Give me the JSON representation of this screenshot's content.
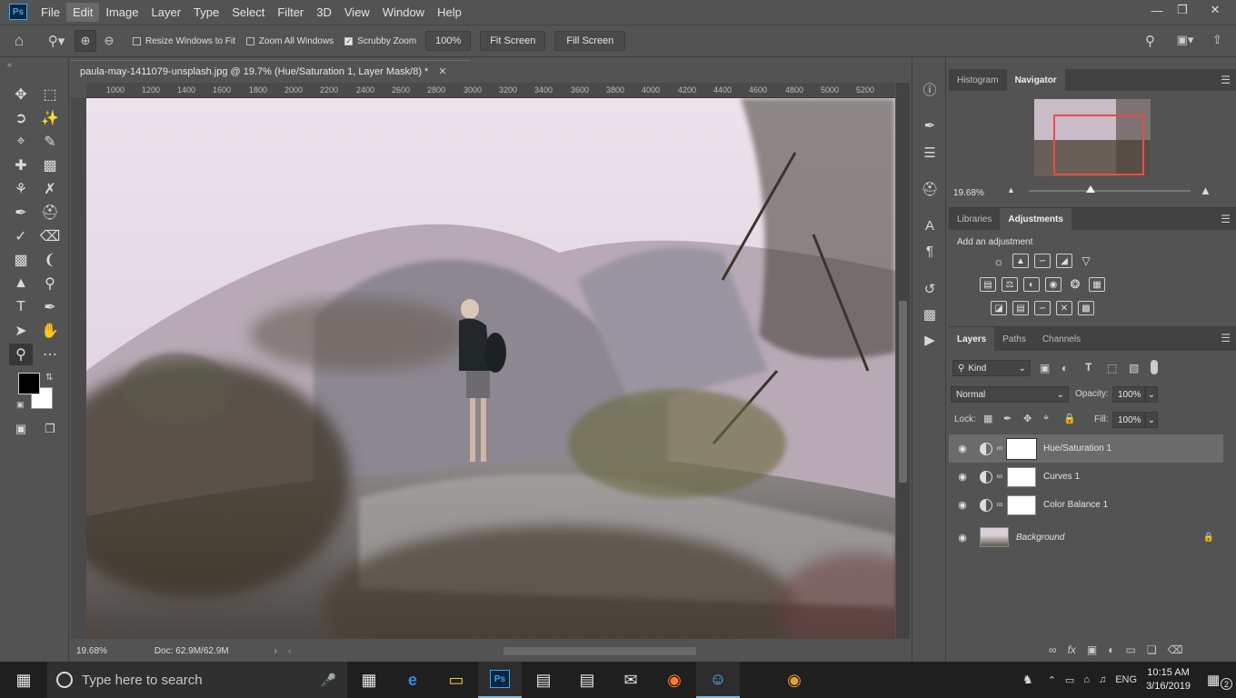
{
  "app": {
    "logo": "Ps"
  },
  "menu": [
    "File",
    "Edit",
    "Image",
    "Layer",
    "Type",
    "Select",
    "Filter",
    "3D",
    "View",
    "Window",
    "Help"
  ],
  "options": {
    "resize_windows": "Resize Windows to Fit",
    "zoom_all": "Zoom All Windows",
    "scrubby": "Scrubby Zoom",
    "zoom_value": "100%",
    "fit_screen": "Fit Screen",
    "fill_screen": "Fill Screen"
  },
  "document": {
    "tab_title": "paula-may-1411079-unsplash.jpg @ 19.7% (Hue/Saturation 1, Layer Mask/8) *",
    "ruler_ticks": [
      "1000",
      "1200",
      "1400",
      "1600",
      "1800",
      "2000",
      "2200",
      "2400",
      "2600",
      "2800",
      "3000",
      "3200",
      "3400",
      "3600",
      "3800",
      "4000",
      "4200",
      "4400",
      "4600",
      "4800",
      "5000",
      "5200"
    ],
    "status_zoom": "19.68%",
    "status_doc": "Doc: 62.9M/62.9M"
  },
  "navigator": {
    "tabs": [
      "Histogram",
      "Navigator"
    ],
    "zoom": "19.68%"
  },
  "adjustments": {
    "tabs": [
      "Libraries",
      "Adjustments"
    ],
    "label": "Add an adjustment"
  },
  "layers": {
    "tabs": [
      "Layers",
      "Paths",
      "Channels"
    ],
    "kind": "Kind",
    "blend_mode": "Normal",
    "opacity_label": "Opacity:",
    "opacity": "100%",
    "lock_label": "Lock:",
    "fill_label": "Fill:",
    "fill": "100%",
    "items": [
      {
        "name": "Hue/Saturation 1"
      },
      {
        "name": "Curves 1"
      },
      {
        "name": "Color Balance 1"
      },
      {
        "name": "Background"
      }
    ]
  },
  "taskbar": {
    "search_placeholder": "Type here to search",
    "lang": "ENG",
    "time": "10:15 AM",
    "date": "3/16/2019",
    "notifications": "2"
  }
}
